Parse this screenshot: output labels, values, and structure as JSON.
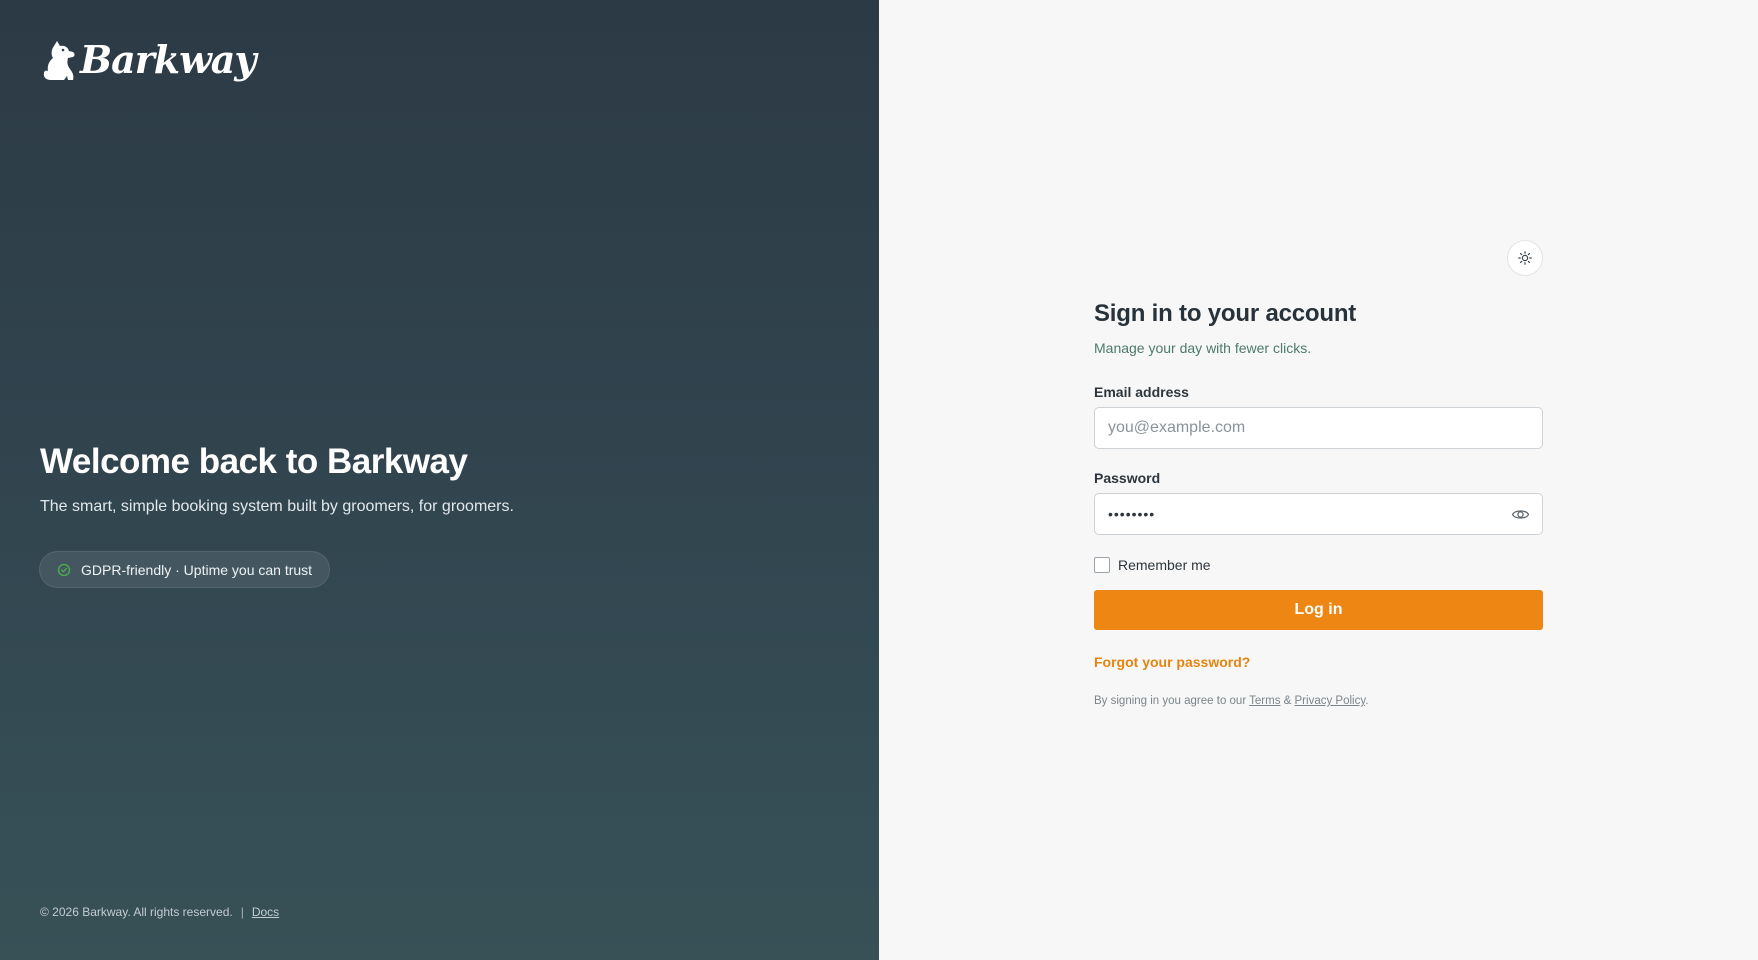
{
  "brand": {
    "name": "Barkway",
    "logo_icon": "dog-icon"
  },
  "hero": {
    "title": "Welcome back to Barkway",
    "subtitle": "The smart, simple booking system built by groomers, for groomers.",
    "badge_icon": "check-circle-icon",
    "badge_text": "GDPR-friendly · Uptime you can trust",
    "footer": {
      "copyright": "© 2026 Barkway. All rights reserved.",
      "separator": "|",
      "docs_link": "Docs"
    }
  },
  "form": {
    "theme_toggle_icon": "sun-icon",
    "title": "Sign in to your account",
    "subtitle": "Manage your day with fewer clicks.",
    "email": {
      "label": "Email address",
      "placeholder": "you@example.com",
      "value": ""
    },
    "password": {
      "label": "Password",
      "value": "••••••••",
      "toggle_icon": "eye-icon"
    },
    "remember_label": "Remember me",
    "remember_checked": false,
    "submit_label": "Log in",
    "forgot_link": "Forgot your password?",
    "legal": {
      "prefix": "By signing in you agree to our ",
      "terms_link": "Terms",
      "amp": " & ",
      "privacy_link": "Privacy Policy",
      "suffix": "."
    }
  },
  "colors": {
    "accent": "#ed8612",
    "hero_bg_top": "#2c3a45",
    "hero_bg_bottom": "#375157",
    "panel_bg": "#f7f7f7",
    "subtitle_green": "#4e7a6a",
    "badge_check": "#4caf50"
  }
}
